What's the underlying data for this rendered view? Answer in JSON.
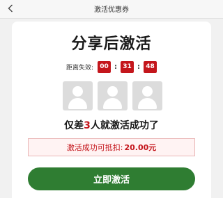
{
  "header": {
    "title": "激活优惠券",
    "back_icon": "chevron-left-icon"
  },
  "main": {
    "title": "分享后激活",
    "countdown": {
      "label": "距离失效:",
      "hours": "00",
      "minutes": "31",
      "seconds": "48",
      "separator": ":"
    },
    "avatars": [
      {
        "icon": "user-placeholder-icon"
      },
      {
        "icon": "user-placeholder-icon"
      },
      {
        "icon": "user-placeholder-icon"
      }
    ],
    "need": {
      "prefix": "仅差",
      "count": "3",
      "suffix": "人就激活成功了"
    },
    "deduct": {
      "label": "激活成功可抵扣:",
      "amount": "20.00元"
    },
    "activate_button": "立即激活"
  },
  "colors": {
    "accent_red": "#c4161c",
    "button_green": "#2f7d32"
  }
}
